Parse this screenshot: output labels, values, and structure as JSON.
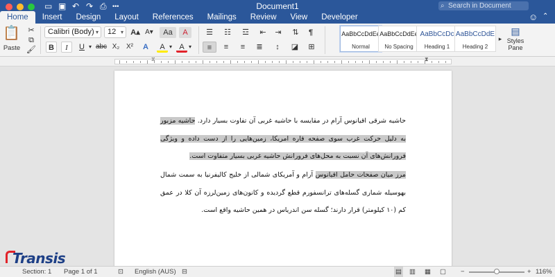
{
  "window": {
    "title": "Document1",
    "search_placeholder": "Search in Document"
  },
  "tabs": [
    {
      "label": "Home",
      "active": true
    },
    {
      "label": "Insert"
    },
    {
      "label": "Design"
    },
    {
      "label": "Layout"
    },
    {
      "label": "References"
    },
    {
      "label": "Mailings"
    },
    {
      "label": "Review"
    },
    {
      "label": "View"
    },
    {
      "label": "Developer"
    }
  ],
  "ribbon": {
    "paste_label": "Paste",
    "font_name": "Calibri (Body)",
    "font_size": "12",
    "bold": "B",
    "italic": "I",
    "underline": "U",
    "strike": "abc",
    "subscript": "X₂",
    "superscript": "X²",
    "grow_font": "A▴",
    "shrink_font": "A▾",
    "change_case": "Aa",
    "clear_format": "A",
    "text_effects": "A",
    "highlight": "A",
    "font_color": "A",
    "styles": [
      {
        "sample": "AaBbCcDdEe",
        "name": "Normal",
        "selected": true
      },
      {
        "sample": "AaBbCcDdEe",
        "name": "No Spacing"
      },
      {
        "sample": "AaBbCcDc",
        "name": "Heading 1",
        "heading": true
      },
      {
        "sample": "AaBbCcDdE",
        "name": "Heading 2",
        "heading": true
      }
    ],
    "styles_pane_label_1": "Styles",
    "styles_pane_label_2": "Pane"
  },
  "document": {
    "paragraph_1": {
      "before": "حاشیه شرقی اقیانوس آرام در مقایسه با حاشیه غربی آن تفاوت بسیار دارد. ",
      "highlighted": "حاشیه مزبور به دلیل حرکت غرب سوی صفحه قاره امریکا، زمین‌هایی را از دست داده و ویژگی فرورانش‌های آن نسبت به محل‌های فرورانش حاشیه غربی بسیار متفاوت است."
    },
    "paragraph_2": {
      "highlighted": "مرز میان صفحات حامل اقیانوس",
      "after": " آرام و آمریکای شمالی از خلیج کالیفرنیا به سمت شمال بهوسیله شماری گسله‌های ترانسفورم قطع گردیده و کانون‌های زمین‌لرزه آن کلا در عمق کم (۱۰ کیلومتر) قرار دارند؛ گسله سن اندریاس در همین حاشیه واقع است."
    }
  },
  "status": {
    "section": "Section: 1",
    "page": "Page 1 of 1",
    "language": "English (AUS)",
    "zoom": "116%",
    "zoom_minus": "−",
    "zoom_plus": "+"
  },
  "logo": {
    "text": "Transis"
  },
  "colors": {
    "brand_blue": "#2b579a",
    "highlight_gray": "#c9c9c9",
    "highlighter_yellow": "#ffeb00",
    "font_color_red": "#e2232a"
  }
}
